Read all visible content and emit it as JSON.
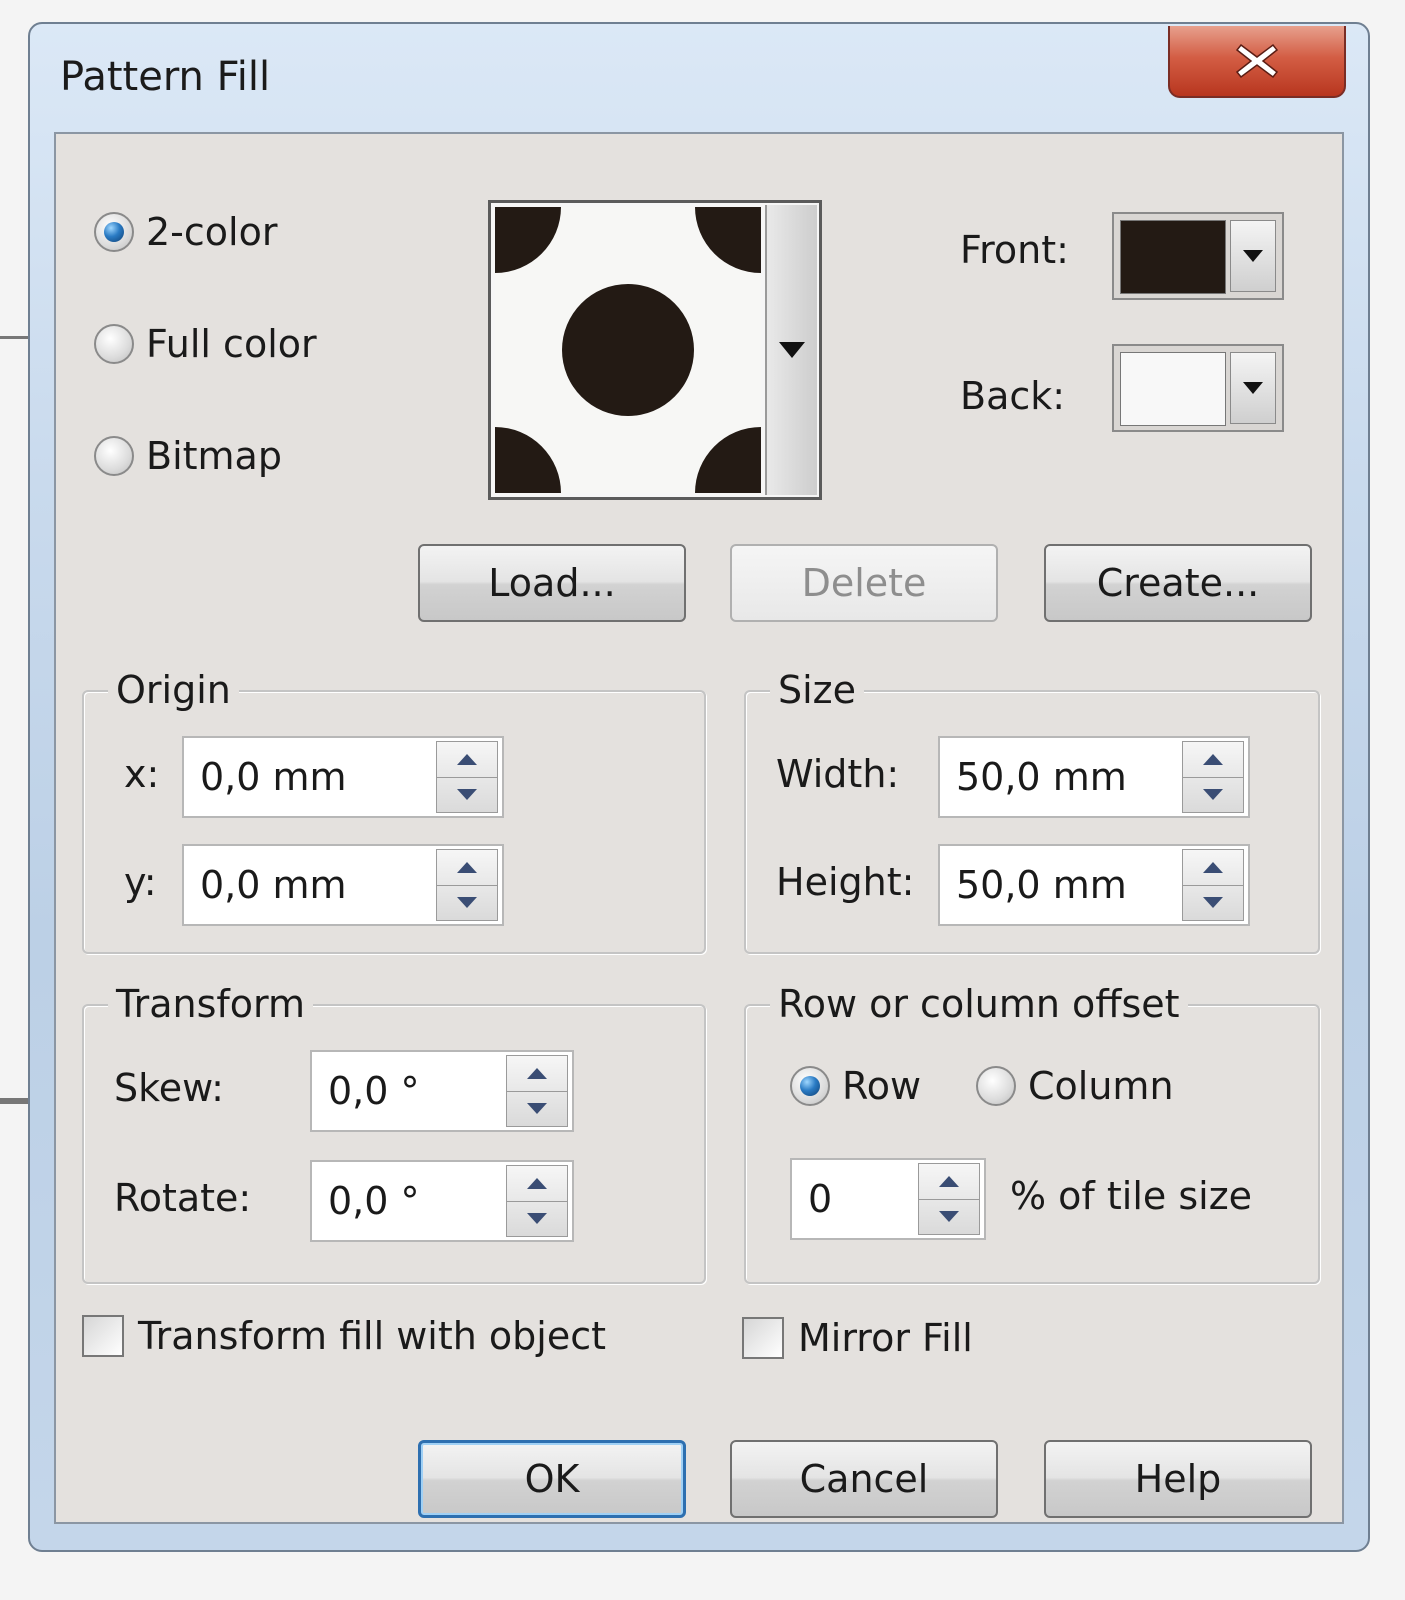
{
  "window": {
    "title": "Pattern Fill"
  },
  "type_options": [
    {
      "label": "2-color",
      "selected": true
    },
    {
      "label": "Full color",
      "selected": false
    },
    {
      "label": "Bitmap",
      "selected": false
    }
  ],
  "colors": {
    "front_label": "Front:",
    "back_label": "Back:",
    "front_color": "#231a14",
    "back_color": "#f8f8f8"
  },
  "pattern_buttons": {
    "load": "Load...",
    "delete": "Delete",
    "create": "Create..."
  },
  "origin": {
    "title": "Origin",
    "x_label": "x:",
    "x_value": "0,0 mm",
    "y_label": "y:",
    "y_value": "0,0 mm"
  },
  "size": {
    "title": "Size",
    "width_label": "Width:",
    "width_value": "50,0 mm",
    "height_label": "Height:",
    "height_value": "50,0 mm"
  },
  "transform": {
    "title": "Transform",
    "skew_label": "Skew:",
    "skew_value": "0,0 °",
    "rotate_label": "Rotate:",
    "rotate_value": "0,0 °"
  },
  "offset": {
    "title": "Row or column offset",
    "row_label": "Row",
    "row_selected": true,
    "column_label": "Column",
    "column_selected": false,
    "value": "0",
    "unit_label": "% of tile size"
  },
  "options": {
    "transform_fill_label": "Transform fill with object",
    "mirror_fill_label": "Mirror Fill"
  },
  "footer": {
    "ok": "OK",
    "cancel": "Cancel",
    "help": "Help"
  }
}
